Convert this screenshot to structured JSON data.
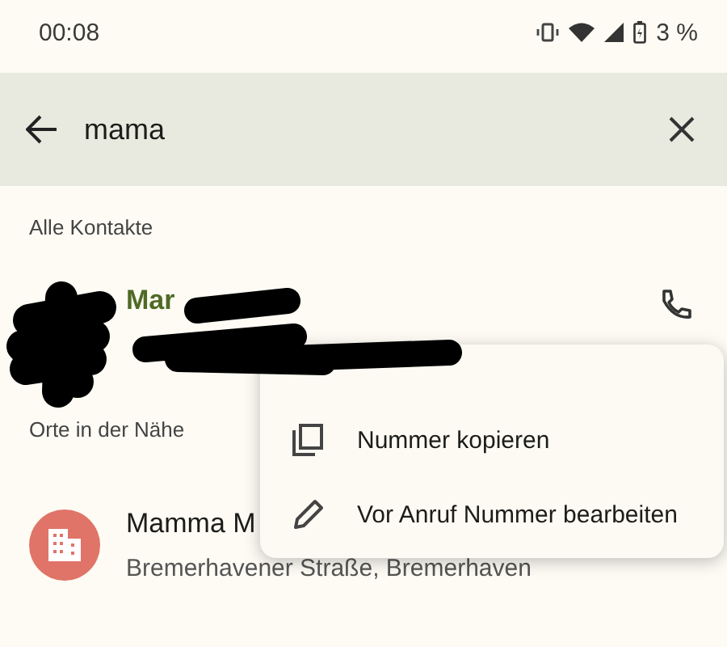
{
  "status_bar": {
    "time": "00:08",
    "battery": "3 %"
  },
  "search": {
    "value": "mama"
  },
  "sections": [
    {
      "title": "Alle Kontakte",
      "items": [
        {
          "kind": "contact",
          "name": "Mar"
        }
      ]
    },
    {
      "title": "Orte in der Nähe",
      "items": [
        {
          "kind": "place",
          "name": "Mamma M",
          "address": "Bremerhavener Straße, Bremerhaven"
        }
      ]
    }
  ],
  "menu": [
    {
      "kind": "copy",
      "label": "Nummer kopieren"
    },
    {
      "kind": "edit",
      "label": "Vor Anruf Nummer bearbeiten"
    }
  ]
}
